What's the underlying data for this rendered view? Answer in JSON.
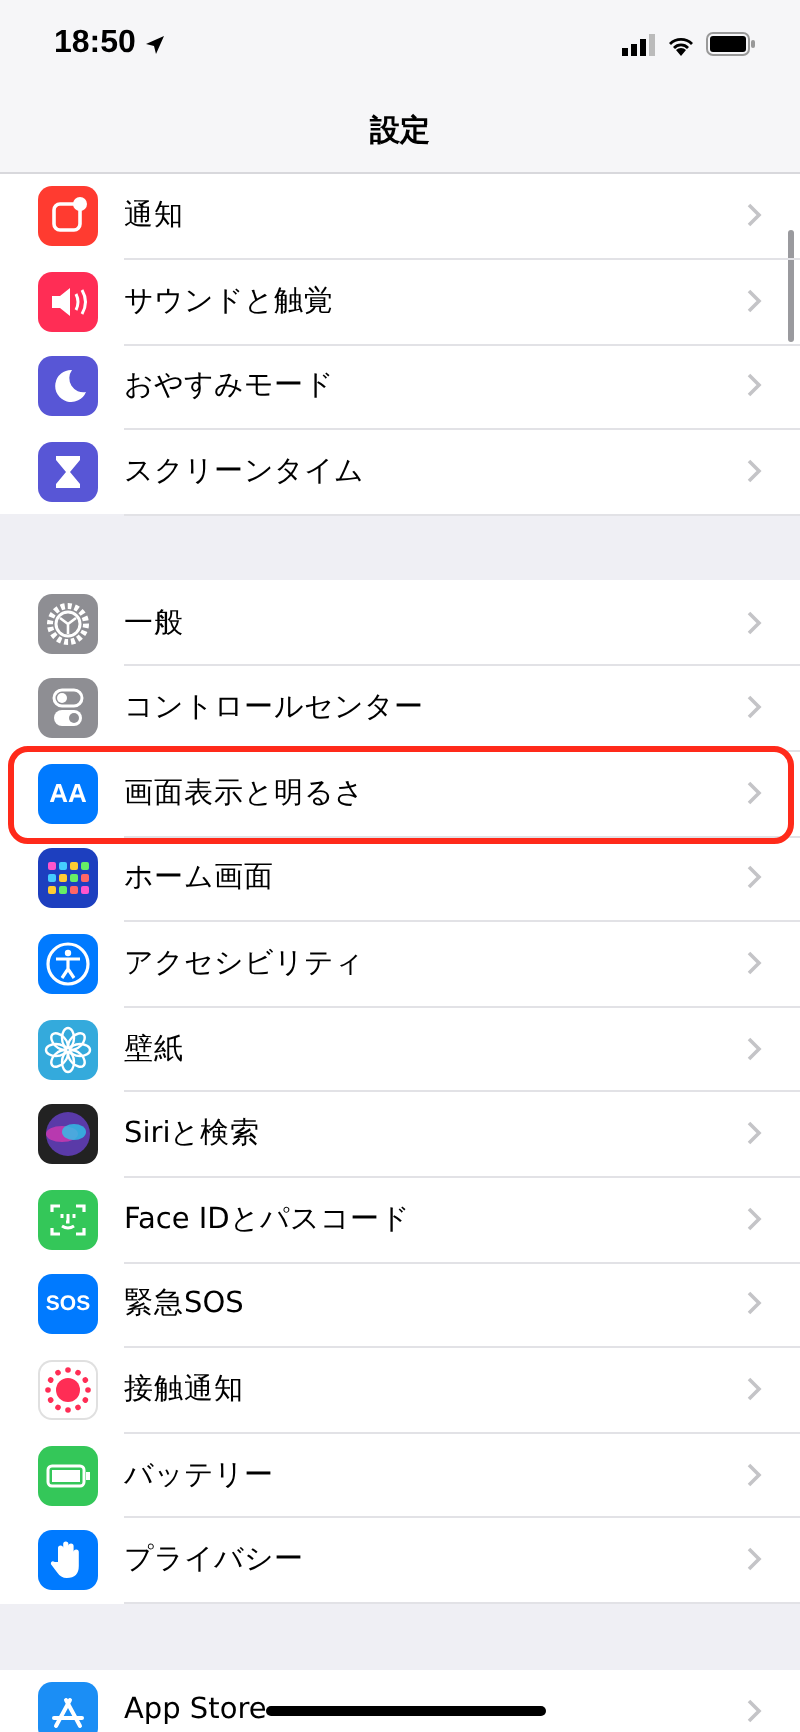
{
  "status_bar": {
    "time": "18:50"
  },
  "nav": {
    "title": "設定"
  },
  "groups": [
    {
      "items": [
        {
          "label": "通知",
          "kind": "notification",
          "highlighted": false
        },
        {
          "label": "サウンドと触覚",
          "kind": "sound",
          "highlighted": false
        },
        {
          "label": "おやすみモード",
          "kind": "moon",
          "highlighted": false
        },
        {
          "label": "スクリーンタイム",
          "kind": "hourglass",
          "highlighted": false
        }
      ]
    },
    {
      "items": [
        {
          "label": "一般",
          "kind": "gear",
          "highlighted": false
        },
        {
          "label": "コントロールセンター",
          "kind": "toggles",
          "highlighted": false
        },
        {
          "label": "画面表示と明るさ",
          "kind": "text",
          "icon_text": "AA",
          "highlighted": true
        },
        {
          "label": "ホーム画面",
          "kind": "grid",
          "highlighted": false
        },
        {
          "label": "アクセシビリティ",
          "kind": "accessibility",
          "highlighted": false
        },
        {
          "label": "壁紙",
          "kind": "flower",
          "highlighted": false
        },
        {
          "label": "Siriと検索",
          "kind": "orb",
          "highlighted": false
        },
        {
          "label": "Face IDとパスコード",
          "kind": "face",
          "highlighted": false
        },
        {
          "label": "緊急SOS",
          "kind": "text",
          "icon_text": "SOS",
          "highlighted": false
        },
        {
          "label": "接触通知",
          "kind": "dots",
          "highlighted": false
        },
        {
          "label": "バッテリー",
          "kind": "battery",
          "highlighted": false
        },
        {
          "label": "プライバシー",
          "kind": "hand",
          "highlighted": false
        }
      ]
    },
    {
      "items": [
        {
          "label": "App Store",
          "kind": "appstore",
          "highlighted": false
        }
      ]
    }
  ]
}
